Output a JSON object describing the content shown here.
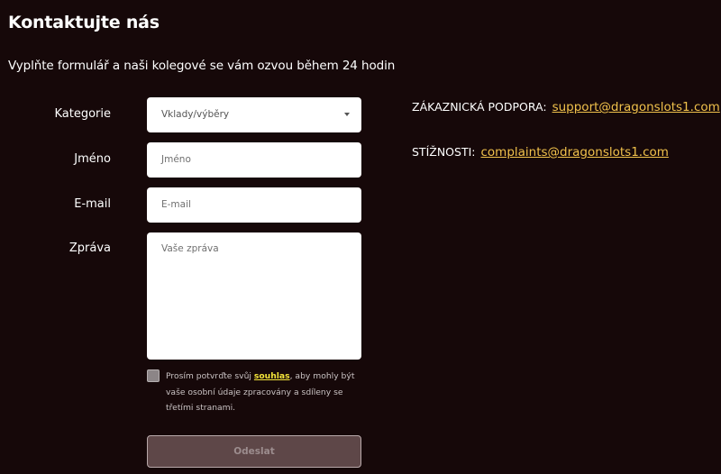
{
  "page": {
    "title": "Kontaktujte nás",
    "subtitle": "Vyplňte formulář a naši kolegové se vám ozvou během 24 hodin"
  },
  "form": {
    "category_label": "Kategorie",
    "category_value": "Vklady/výběry",
    "name_label": "Jméno",
    "name_placeholder": "Jméno",
    "email_label": "E-mail",
    "email_placeholder": "E-mail",
    "message_label": "Zpráva",
    "message_placeholder": "Vaše zpráva",
    "consent_before": "Prosím potvrďte svůj ",
    "consent_link": "souhlas",
    "consent_after": ", aby mohly být vaše osobní údaje zpracovány a sdíleny se třetími stranami.",
    "submit_label": "Odeslat"
  },
  "contacts": {
    "support_label": "ZÁKAZNICKÁ PODPORA:",
    "support_email": "support@dragonslots1.com",
    "complaints_label": "STÍŽNOSTI:",
    "complaints_email": "complaints@dragonslots1.com"
  },
  "colors": {
    "background": "#160809",
    "link_accent": "#f0c14b",
    "consent_link": "#f5e63a",
    "submit_bg": "#5e4748"
  },
  "icons": {
    "category_dropdown": "caret-down-icon"
  }
}
